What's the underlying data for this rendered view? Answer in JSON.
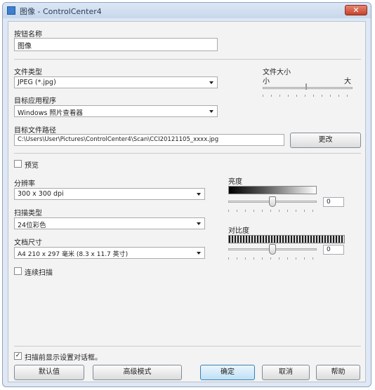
{
  "window": {
    "title": "图像 - ControlCenter4",
    "close_glyph": "✕"
  },
  "button_name": {
    "label": "按钮名称",
    "value": "图像"
  },
  "file_type": {
    "label": "文件类型",
    "selected": "JPEG (*.jpg)"
  },
  "file_size": {
    "label": "文件大小",
    "small": "小",
    "large": "大"
  },
  "target_app": {
    "label": "目标应用程序",
    "selected": "Windows 照片查看器"
  },
  "file_path": {
    "label": "目标文件路径",
    "value": "C:\\Users\\User\\Pictures\\ControlCenter4\\Scan\\CCI20121105_xxxx.jpg",
    "change_button": "更改"
  },
  "preview": {
    "label": "预览",
    "checked": false
  },
  "resolution": {
    "label": "分辨率",
    "selected": "300 x 300 dpi"
  },
  "scan_type": {
    "label": "扫描类型",
    "selected": "24位彩色"
  },
  "document_size": {
    "label": "文档尺寸",
    "selected": "A4 210 x 297 毫米 (8.3 x 11.7 英寸)"
  },
  "continuous_scan": {
    "label": "连续扫描",
    "checked": false
  },
  "brightness": {
    "label": "亮度",
    "value": "0"
  },
  "contrast": {
    "label": "对比度",
    "value": "0"
  },
  "show_settings": {
    "label": "扫描前显示设置对话框。",
    "checked": true,
    "check_glyph": "✓"
  },
  "footer": {
    "default": "默认值",
    "advanced": "高级模式",
    "ok": "确定",
    "cancel": "取消",
    "help": "帮助"
  },
  "colors": {
    "title_bar": "#c7d7ec",
    "close_button": "#c5432b",
    "default_button": "#bfe0f6",
    "dialog_bg": "#f3f3f3"
  },
  "icons": {
    "app": "app-icon",
    "close": "close-icon",
    "dropdown": "chevron-down-icon"
  }
}
